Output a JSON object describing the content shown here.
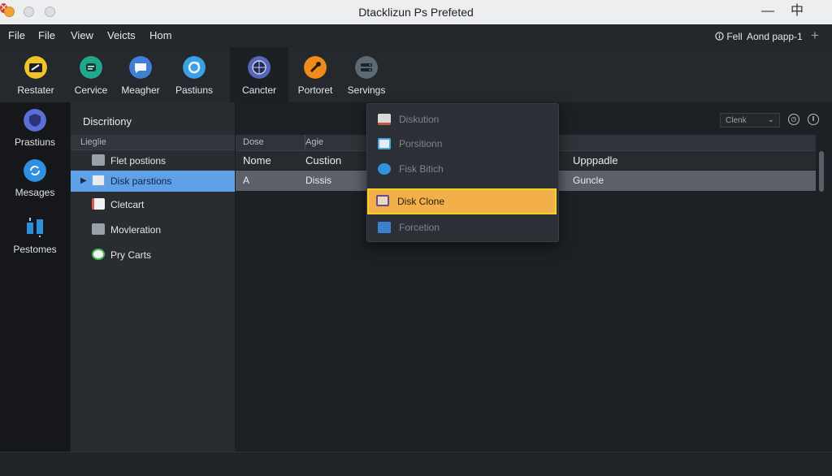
{
  "window": {
    "title": "Dtacklizun Ps Prefeted",
    "controls": {
      "minimize": "—",
      "restore": "中",
      "close": "✕"
    }
  },
  "menubar": {
    "items": [
      "File",
      "File",
      "View",
      "Veicts",
      "Hom"
    ],
    "right_label": "Fell",
    "right_text": "Aond papp-1",
    "add": "+"
  },
  "toolbar": {
    "items": [
      {
        "label": "Restater",
        "icon": "restore-icon",
        "color": "#f0c329"
      },
      {
        "label": "Cervice",
        "icon": "chat-icon",
        "color": "#1fa88a"
      },
      {
        "label": "Meagher",
        "icon": "message-icon",
        "color": "#3f7fd6"
      },
      {
        "label": "Pastiuns",
        "icon": "refresh-icon",
        "color": "#3aa0e6"
      },
      {
        "label": "Cancter",
        "icon": "globe-icon",
        "color": "#5865b8"
      },
      {
        "label": "Portoret",
        "icon": "tools-icon",
        "color": "#f08a1c"
      },
      {
        "label": "Servings",
        "icon": "server-icon",
        "color": "#5d6a76"
      }
    ]
  },
  "leftnav": {
    "items": [
      {
        "label": "Prastiuns",
        "icon": "shield-icon",
        "color": "#5b6fd6"
      },
      {
        "label": "Mesages",
        "icon": "sync-icon",
        "color": "#2f8fe0"
      },
      {
        "label": "Pestomes",
        "icon": "transfer-icon",
        "color": "#2a8fdc"
      }
    ]
  },
  "sidepanel": {
    "title": "Discritiony",
    "header": "Lieglie",
    "items": [
      {
        "label": "Flet postions",
        "selected": false,
        "color": "#9aa0a8"
      },
      {
        "label": "Disk parstions",
        "selected": true,
        "color": "#e7ecf3"
      },
      {
        "label": "Cletcart",
        "selected": false,
        "color": "#e05a4a"
      },
      {
        "label": "Movleration",
        "selected": false,
        "color": "#9aa0a8"
      },
      {
        "label": "Pry Carts",
        "selected": false,
        "color": "#4cbb5a"
      }
    ]
  },
  "main": {
    "filter": {
      "value": "Clenk",
      "arrow": "⌄"
    },
    "header_row": [
      "Dose",
      "Agie"
    ],
    "columns": [
      "Nome",
      "Custion",
      "Upppadle"
    ],
    "row": {
      "col1": "A",
      "col2": "Dissis",
      "col3": "Guncle"
    }
  },
  "context_menu": {
    "items": [
      {
        "label": "Diskution",
        "highlighted": false,
        "color": "#c5543d"
      },
      {
        "label": "Porsitionn",
        "highlighted": false,
        "color": "#4aa8e0"
      },
      {
        "label": "Fisk Bitich",
        "highlighted": false,
        "color": "#2f94e0"
      },
      {
        "label": "Disk Clone",
        "highlighted": true,
        "color": "#6b4a8c"
      },
      {
        "label": "Forcetion",
        "highlighted": false,
        "color": "#3b7fd0"
      }
    ]
  }
}
